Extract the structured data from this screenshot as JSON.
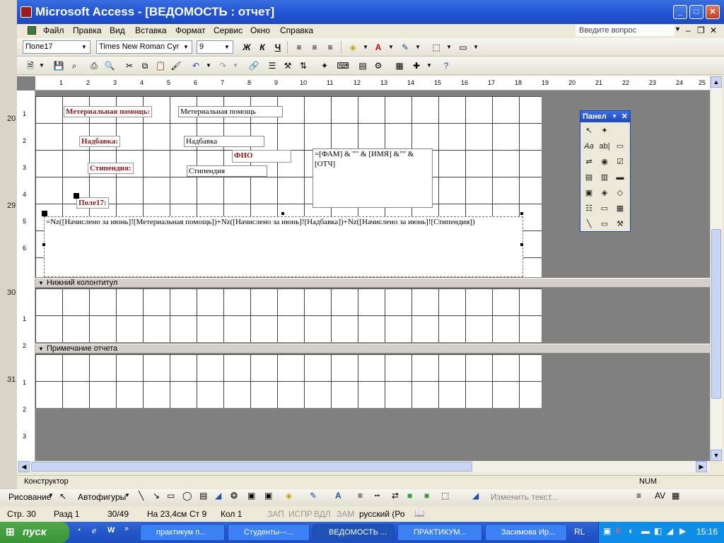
{
  "window": {
    "title": "Microsoft Access - [ВЕДОМОСТЬ : отчет]"
  },
  "menu": {
    "items": [
      "Файл",
      "Правка",
      "Вид",
      "Вставка",
      "Формат",
      "Сервис",
      "Окно",
      "Справка"
    ],
    "help_placeholder": "Введите вопрос"
  },
  "format_toolbar": {
    "object": "Поле17",
    "font": "Times New Roman Cyr",
    "size": "9",
    "bold": "Ж",
    "italic": "К",
    "underline": "Ч"
  },
  "ruler": {
    "top": [
      "1",
      "2",
      "3",
      "4",
      "5",
      "6",
      "7",
      "8",
      "9",
      "10",
      "11",
      "12",
      "13",
      "14",
      "15",
      "16",
      "17",
      "18",
      "19",
      "20",
      "21",
      "22",
      "23",
      "24",
      "25"
    ],
    "left": [
      "1",
      "2",
      "3",
      "4",
      "5",
      "6",
      "1",
      "2",
      "1",
      "2",
      "3"
    ]
  },
  "report": {
    "labels": {
      "material": "Метериальная помощь:",
      "nadbavka": "Надбавка:",
      "stipendia": "Стипендия:",
      "pole17": "Поле17:",
      "fio": "ФИО"
    },
    "fields": {
      "material": "Метериальная помощь",
      "nadbavka": "Надбавка",
      "stipendia": "Стипендия",
      "fio_expr": "=[ФАМ] & \"\" & [ИМЯ] &\"\" & [ОТЧ]",
      "sum_expr": "=Nz([Начислено за июнь]![Метериальная помощь])+Nz([Начислено за июнь]![Надбавка])+Nz([Начислено за июнь]![Стипендия])"
    },
    "sections": {
      "footer": "Нижний колонтитул",
      "report_note": "Примечание отчета"
    }
  },
  "toolbox": {
    "title": "Панел"
  },
  "statusbar": {
    "mode": "Конструктор",
    "num": "NUM"
  },
  "drawbar": {
    "drawing": "Рисование",
    "autoshapes": "Автофигуры",
    "change_text": "Изменить текст..."
  },
  "word_status": {
    "page": "Стр. 30",
    "section": "Разд 1",
    "pages": "30/49",
    "at": "На 23,4см",
    "line": "Ст 9",
    "col": "Кол 1",
    "rec": "ЗАП",
    "trk": "ИСПР",
    "ext": "ВДЛ",
    "ovr": "ЗАМ",
    "lang": "русский (Ро"
  },
  "background_numbers": [
    "20",
    "29",
    "30",
    "31"
  ],
  "taskbar": {
    "start": "пуск",
    "tasks": [
      "практикум п...",
      "Студенты---...",
      "ВЕДОМОСТЬ ...",
      "ПРАКТИКУМ...",
      "Засимова Ир..."
    ],
    "lang": "RL",
    "time": "15:16"
  },
  "colors": {
    "title_blue": "#2457d6",
    "label_red": "#8b1a1a",
    "workspace_gray": "#808080"
  }
}
